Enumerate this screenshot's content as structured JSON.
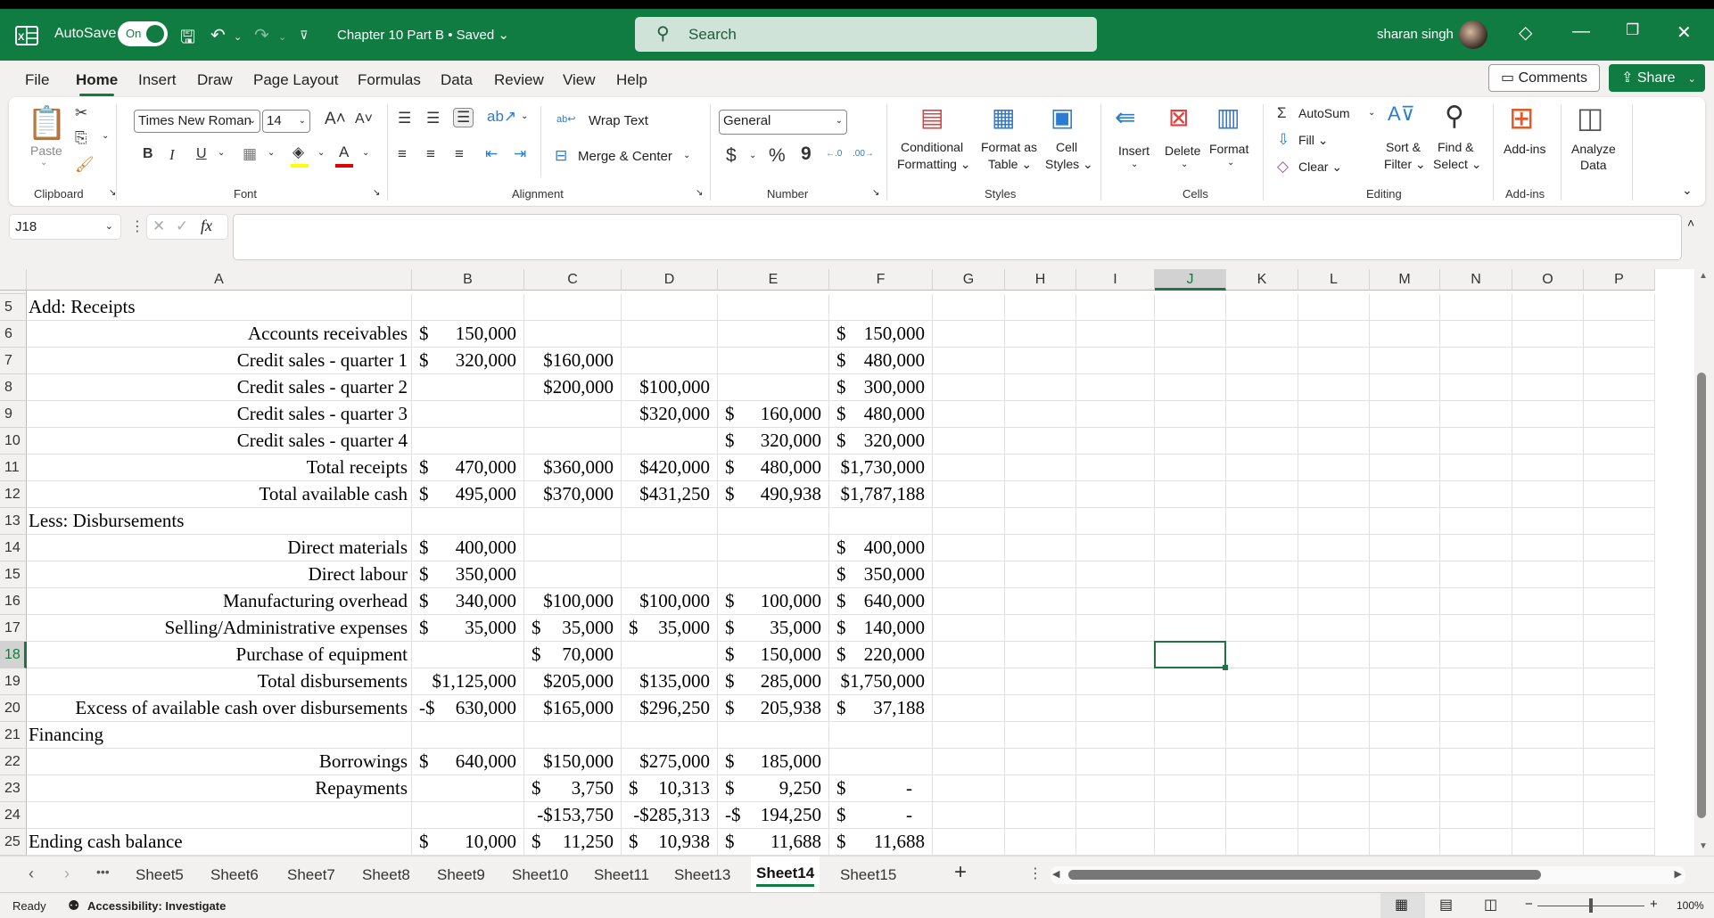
{
  "titlebar": {
    "autosave_label": "AutoSave",
    "autosave_state": "On",
    "doc_title": "Chapter 10 Part B • Saved ⌄",
    "search_placeholder": "Search",
    "user_name": "sharan singh"
  },
  "menu": [
    "File",
    "Home",
    "Insert",
    "Draw",
    "Page Layout",
    "Formulas",
    "Data",
    "Review",
    "View",
    "Help"
  ],
  "menu_active": "Home",
  "actions": {
    "comments": "Comments",
    "share": "Share"
  },
  "ribbon": {
    "clipboard": {
      "label": "Clipboard",
      "paste": "Paste"
    },
    "font": {
      "label": "Font",
      "family": "Times New Roman",
      "size": "14",
      "bold": "B",
      "italic": "I",
      "underline": "U",
      "fill_color": "#ffff00",
      "font_color": "#e00000"
    },
    "alignment": {
      "label": "Alignment",
      "wrap_text": "Wrap Text",
      "merge_center": "Merge & Center"
    },
    "number": {
      "label": "Number",
      "format": "General",
      "currency": "$",
      "percent": "%",
      "comma": "9",
      "inc_decimal": "←.0 .00",
      "dec_decimal": ".00 →.0"
    },
    "styles": {
      "label": "Styles",
      "conditional": "Conditional",
      "conditional2": "Formatting ⌄",
      "format_table": "Format as",
      "format_table2": "Table ⌄",
      "cell_styles": "Cell",
      "cell_styles2": "Styles ⌄"
    },
    "cells": {
      "label": "Cells",
      "insert": "Insert",
      "delete": "Delete",
      "format": "Format"
    },
    "editing": {
      "label": "Editing",
      "autosum": "AutoSum",
      "fill": "Fill ⌄",
      "clear": "Clear ⌄",
      "sort": "Sort &",
      "sort2": "Filter ⌄",
      "find": "Find &",
      "find2": "Select ⌄"
    },
    "addins": {
      "label": "Add-ins",
      "addins": "Add-ins"
    },
    "analyze": {
      "line1": "Analyze",
      "line2": "Data"
    }
  },
  "formula_bar": {
    "name_box": "J18",
    "fx": "fx",
    "formula": ""
  },
  "columns": [
    "A",
    "B",
    "C",
    "D",
    "E",
    "F",
    "G",
    "H",
    "I",
    "J",
    "K",
    "L",
    "M",
    "N",
    "O",
    "P"
  ],
  "selected_cell": "J18",
  "rows": [
    {
      "n": "5",
      "a": "Add: Receipts",
      "a_align": "l",
      "b": "",
      "c": "",
      "d": "",
      "e": "",
      "f": ""
    },
    {
      "n": "6",
      "a": "Accounts receivables",
      "b": "$|150,000",
      "c": "",
      "d": "",
      "e": "",
      "f": "$|150,000"
    },
    {
      "n": "7",
      "a": "Credit sales - quarter 1",
      "b": "$|320,000",
      "c": "$160,000",
      "d": "",
      "e": "",
      "f": "$|480,000"
    },
    {
      "n": "8",
      "a": "Credit sales - quarter 2",
      "b": "",
      "c": "$200,000",
      "d": "$100,000",
      "e": "",
      "f": "$|300,000"
    },
    {
      "n": "9",
      "a": "Credit sales - quarter 3",
      "b": "",
      "c": "",
      "d": "$320,000",
      "e": "$|160,000",
      "f": "$|480,000"
    },
    {
      "n": "10",
      "a": "Credit sales - quarter 4",
      "b": "",
      "c": "",
      "d": "",
      "e": "$|320,000",
      "f": "$|320,000"
    },
    {
      "n": "11",
      "a": "Total receipts",
      "b": "$|470,000",
      "c": "$360,000",
      "d": "$420,000",
      "e": "$|480,000",
      "f": "$1,730,000"
    },
    {
      "n": "12",
      "a": "Total available cash",
      "b": "$|495,000",
      "c": "$370,000",
      "d": "$431,250",
      "e": "$|490,938",
      "f": "$1,787,188"
    },
    {
      "n": "13",
      "a": "Less: Disbursements",
      "a_align": "l",
      "b": "",
      "c": "",
      "d": "",
      "e": "",
      "f": ""
    },
    {
      "n": "14",
      "a": "Direct materials",
      "b": "$|400,000",
      "c": "",
      "d": "",
      "e": "",
      "f": "$|400,000"
    },
    {
      "n": "15",
      "a": "Direct labour",
      "b": "$|350,000",
      "c": "",
      "d": "",
      "e": "",
      "f": "$|350,000"
    },
    {
      "n": "16",
      "a": "Manufacturing overhead",
      "b": "$|340,000",
      "c": "$100,000",
      "d": "$100,000",
      "e": "$|100,000",
      "f": "$|640,000"
    },
    {
      "n": "17",
      "a": "Selling/Administrative expenses",
      "b": "$|35,000",
      "c": "$|35,000",
      "d": "$|35,000",
      "e": "$|35,000",
      "f": "$|140,000"
    },
    {
      "n": "18",
      "a": "Purchase of equipment",
      "b": "",
      "c": "$|70,000",
      "d": "",
      "e": "$|150,000",
      "f": "$|220,000"
    },
    {
      "n": "19",
      "a": "Total disbursements",
      "b": "$1,125,000",
      "c": "$205,000",
      "d": "$135,000",
      "e": "$|285,000",
      "f": "$1,750,000"
    },
    {
      "n": "20",
      "a": "Excess of available cash over disbursements",
      "b": "-$|630,000",
      "c": "$165,000",
      "d": "$296,250",
      "e": "$|205,938",
      "f": "$|37,188"
    },
    {
      "n": "21",
      "a": "Financing",
      "a_align": "l",
      "b": "",
      "c": "",
      "d": "",
      "e": "",
      "f": ""
    },
    {
      "n": "22",
      "a": "Borrowings",
      "b": "$|640,000",
      "c": "$150,000",
      "d": "$275,000",
      "e": "$|185,000",
      "f": ""
    },
    {
      "n": "23",
      "a": "Repayments",
      "b": "",
      "c": "$|3,750",
      "d": "$|10,313",
      "e": "$|9,250",
      "f": "$|-"
    },
    {
      "n": "24",
      "a": "",
      "b": "",
      "c": "-$153,750",
      "d": "-$285,313",
      "e": "-$|194,250",
      "f": "$|-"
    },
    {
      "n": "25",
      "a": "Ending cash balance",
      "a_align": "l",
      "b": "$|10,000",
      "c": "$|11,250",
      "d": "$|10,938",
      "e": "$|11,688",
      "f": "$|11,688"
    }
  ],
  "sheets": [
    "Sheet5",
    "Sheet6",
    "Sheet7",
    "Sheet8",
    "Sheet9",
    "Sheet10",
    "Sheet11",
    "Sheet13",
    "Sheet14",
    "Sheet15"
  ],
  "active_sheet": "Sheet14",
  "status": {
    "ready": "Ready",
    "accessibility": "Accessibility: Investigate",
    "zoom": "100%",
    "zoom_fraction": 0.5
  }
}
